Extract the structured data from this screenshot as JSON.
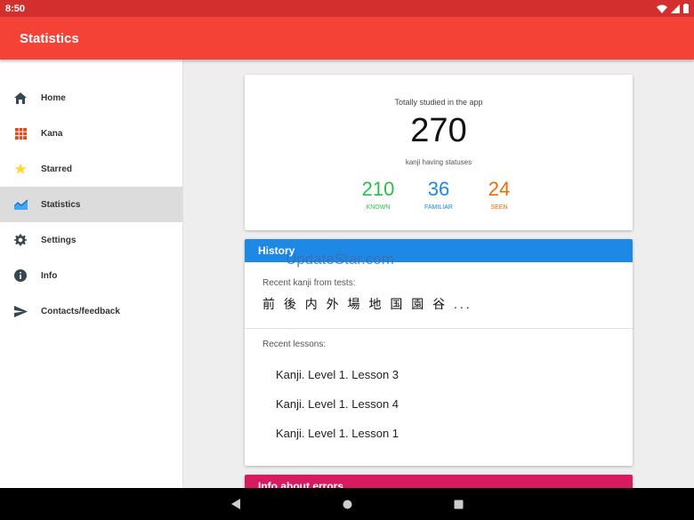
{
  "status_bar": {
    "time": "8:50"
  },
  "app_bar": {
    "title": "Statistics"
  },
  "drawer": {
    "items": [
      {
        "label": "Home",
        "icon": "home-icon"
      },
      {
        "label": "Kana",
        "icon": "kana-grid-icon"
      },
      {
        "label": "Starred",
        "icon": "star-icon"
      },
      {
        "label": "Statistics",
        "icon": "chart-icon",
        "active": true
      },
      {
        "label": "Settings",
        "icon": "gear-icon"
      },
      {
        "label": "Info",
        "icon": "info-icon"
      },
      {
        "label": "Contacts/feedback",
        "icon": "send-icon"
      }
    ]
  },
  "stats": {
    "caption": "Totally studied in the app",
    "total": "270",
    "subcaption": "kanji having statuses",
    "known": {
      "value": "210",
      "label": "KNOWN",
      "color": "#2ebd4a"
    },
    "familiar": {
      "value": "36",
      "label": "FAMILIAR",
      "color": "#1e88e5"
    },
    "seen": {
      "value": "24",
      "label": "SEEN",
      "color": "#ef6c00"
    }
  },
  "history": {
    "title": "History",
    "recent_tests_label": "Recent kanji from tests:",
    "recent_kanji": "前 後 内 外 場 地 国 園 谷 ...",
    "recent_lessons_label": "Recent lessons:",
    "lessons": [
      "Kanji. Level 1. Lesson 3",
      "Kanji. Level 1. Lesson 4",
      "Kanji. Level 1. Lesson 1"
    ]
  },
  "errors_card": {
    "title": "Info about errors"
  },
  "watermark": "UpdateStar.com",
  "colors": {
    "app_bar": "#f44336",
    "status_bar": "#d32f2f",
    "history_header": "#1e88e5",
    "errors_header": "#d81b60"
  }
}
